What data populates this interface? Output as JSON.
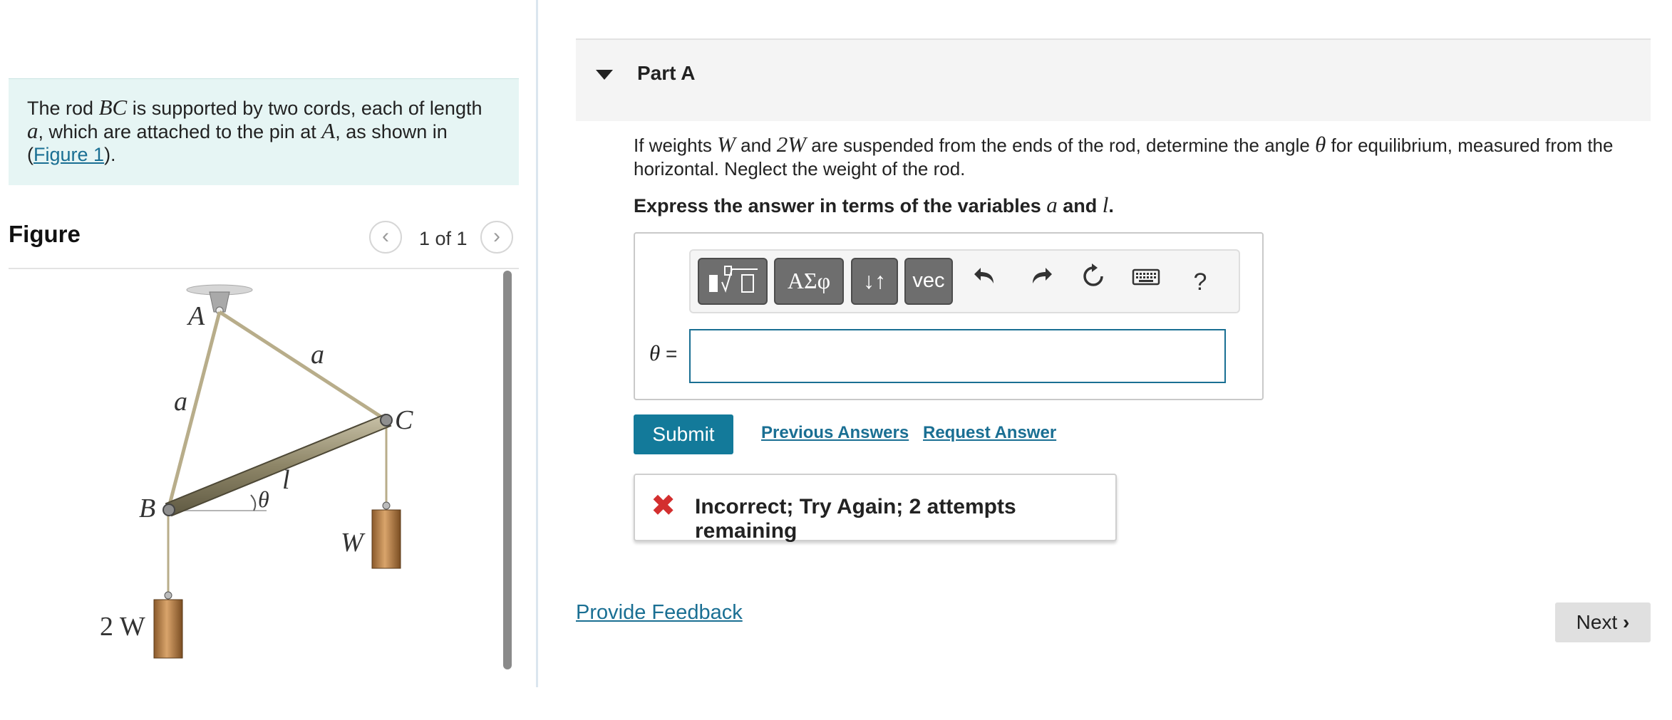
{
  "intro": {
    "text_1": "The rod ",
    "var_bc": "BC",
    "text_2": " is supported by two cords, each of length ",
    "var_a": "a",
    "text_3": ", which are attached to the pin at ",
    "var_A": "A",
    "text_4": ", as shown in (",
    "figure_link": "Figure 1",
    "text_5": ")."
  },
  "figure": {
    "title": "Figure",
    "counter": "1 of 1",
    "labels": {
      "A": "A",
      "B": "B",
      "C": "C",
      "a_left": "a",
      "a_right": "a",
      "l": "l",
      "theta": "θ",
      "W": "W",
      "two_W": "2 W"
    }
  },
  "part": {
    "title": "Part A"
  },
  "question": {
    "t1": "If weights ",
    "w": "W",
    "t2": " and ",
    "w2": "2W",
    "t3": " are suspended from the ends of the rod, determine the angle ",
    "theta": "θ",
    "t4": " for equilibrium, measured from the horizontal. Neglect the weight of the rod."
  },
  "instruction": {
    "t1": "Express the answer in terms of the variables ",
    "a": "a",
    "t2": " and ",
    "l": "l",
    "t3": "."
  },
  "toolbar": {
    "greek": "ΑΣφ",
    "arrows": "↓↑",
    "vec": "vec",
    "help": "?"
  },
  "answer": {
    "label_var": "θ",
    "label_eq": " =",
    "value": ""
  },
  "actions": {
    "submit": "Submit",
    "previous_answers": "Previous Answers",
    "request_answer": "Request Answer"
  },
  "feedback": {
    "text": "Incorrect; Try Again; 2 attempts remaining",
    "color": "#d32f2f"
  },
  "footer": {
    "provide_feedback": "Provide Feedback",
    "next": "Next"
  }
}
